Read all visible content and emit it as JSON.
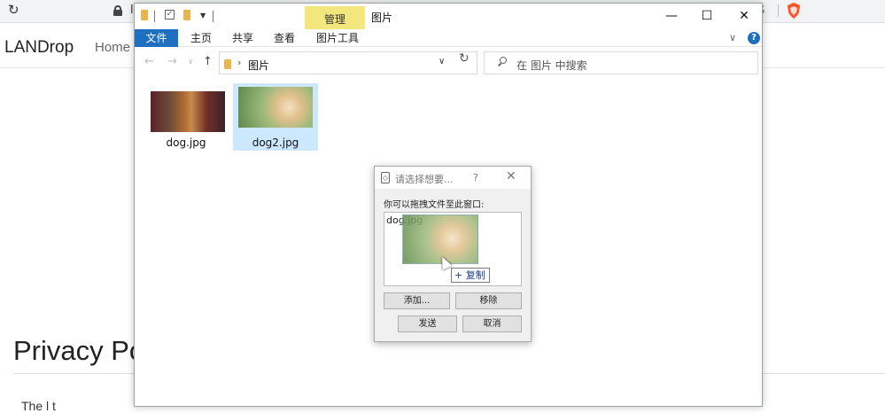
{
  "browser": {
    "reload_icon": "reload-icon",
    "address_partial": "l",
    "ext_text": "ß",
    "brand_name": "LANDrop",
    "nav_home": "Home",
    "heading": "Privacy Po",
    "body_partial": "The l       t"
  },
  "explorer": {
    "manage_tab": "管理",
    "title": "图片",
    "min_symbol": "—",
    "max_symbol": "☐",
    "close_symbol": "✕",
    "ribbon_tabs": [
      "文件",
      "主页",
      "共享",
      "查看",
      "图片工具"
    ],
    "help_symbol": "?",
    "nav_back": "←",
    "nav_forward": "→",
    "nav_recent": "∨",
    "nav_up": "↑",
    "breadcrumb": "图片",
    "refresh_symbol": "↻",
    "search_placeholder": "在 图片 中搜索",
    "files": [
      {
        "name": "dog.jpg",
        "selected": false
      },
      {
        "name": "dog2.jpg",
        "selected": true
      }
    ]
  },
  "dialog": {
    "title": "请选择想要...",
    "help": "?",
    "close": "✕",
    "hint": "你可以拖拽文件至此窗口:",
    "list_item": "dog.jpg",
    "drag_badge": "+ 复制",
    "btn_add": "添加...",
    "btn_remove": "移除",
    "btn_send": "发送",
    "btn_cancel": "取消"
  },
  "colors": {
    "ribbon_file_tab": "#1f6fc1",
    "manage_tab": "#f2e67c",
    "selection": "#cce8ff"
  }
}
